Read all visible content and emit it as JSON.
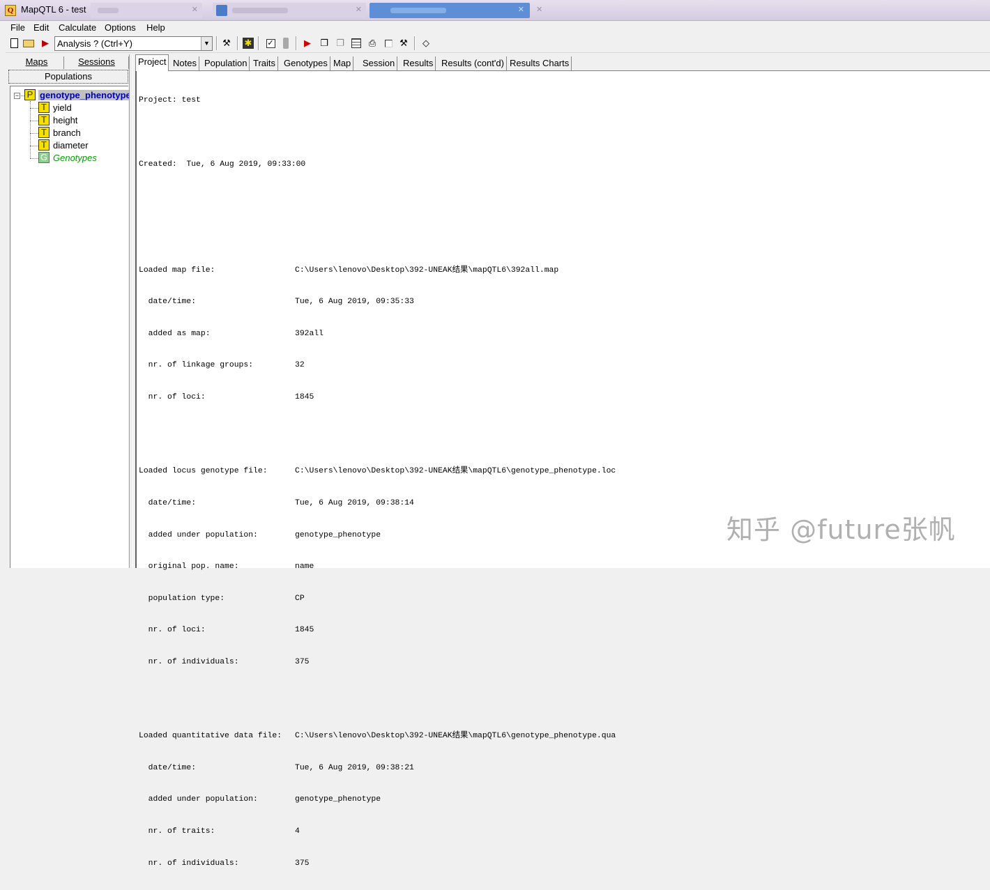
{
  "window": {
    "title": "MapQTL 6 - test",
    "icon": "mapqtl-app-icon"
  },
  "menubar": {
    "items": [
      "File",
      "Edit",
      "Calculate",
      "Options",
      "Help"
    ]
  },
  "toolbar": {
    "analysis_select": "Analysis ? (Ctrl+Y)"
  },
  "left_panel": {
    "tabs": [
      "Maps",
      "Sessions"
    ],
    "active_tab": "Populations",
    "tree": {
      "root": "genotype_phenotype",
      "children": [
        {
          "icon": "T",
          "label": "yield"
        },
        {
          "icon": "T",
          "label": "height"
        },
        {
          "icon": "T",
          "label": "branch"
        },
        {
          "icon": "T",
          "label": "diameter"
        },
        {
          "icon": "G",
          "label": "Genotypes"
        }
      ]
    }
  },
  "tabs": [
    "Project",
    "Notes",
    "Population",
    "Traits",
    "Genotypes",
    "Map",
    "Session",
    "Results",
    "Results (cont'd)",
    "Results Charts"
  ],
  "active_tab": "Project",
  "log": {
    "project": "Project: test",
    "created": "Created:  Tue, 6 Aug 2019, 09:33:00",
    "map_file": {
      "header_key": "Loaded map file:",
      "header_val": "C:\\Users\\lenovo\\Desktop\\392-UNEAK结果\\mapQTL6\\392all.map",
      "rows": [
        {
          "k": "  date/time:",
          "v": "Tue, 6 Aug 2019, 09:35:33"
        },
        {
          "k": "  added as map:",
          "v": "392all"
        },
        {
          "k": "  nr. of linkage groups:",
          "v": "32"
        },
        {
          "k": "  nr. of loci:",
          "v": "1845"
        }
      ]
    },
    "loc_file": {
      "header_key": "Loaded locus genotype file:",
      "header_val": "C:\\Users\\lenovo\\Desktop\\392-UNEAK结果\\mapQTL6\\genotype_phenotype.loc",
      "rows": [
        {
          "k": "  date/time:",
          "v": "Tue, 6 Aug 2019, 09:38:14"
        },
        {
          "k": "  added under population:",
          "v": "genotype_phenotype"
        },
        {
          "k": "  original pop. name:",
          "v": "name"
        },
        {
          "k": "  population type:",
          "v": "CP"
        },
        {
          "k": "  nr. of loci:",
          "v": "1845"
        },
        {
          "k": "  nr. of individuals:",
          "v": "375"
        }
      ]
    },
    "qua_file": {
      "header_key": "Loaded quantitative data file:",
      "header_val": "C:\\Users\\lenovo\\Desktop\\392-UNEAK结果\\mapQTL6\\genotype_phenotype.qua",
      "rows": [
        {
          "k": "  date/time:",
          "v": "Tue, 6 Aug 2019, 09:38:21"
        },
        {
          "k": "  added under population:",
          "v": "genotype_phenotype"
        },
        {
          "k": "  nr. of traits:",
          "v": "4"
        },
        {
          "k": "  nr. of individuals:",
          "v": "375"
        }
      ]
    }
  },
  "watermark": "知乎 @future张帆"
}
